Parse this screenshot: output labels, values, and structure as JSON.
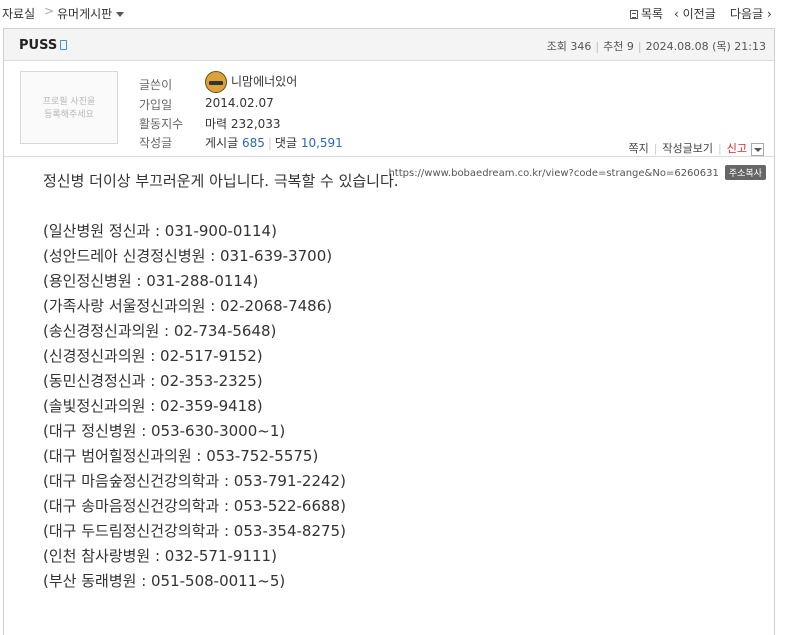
{
  "breadcrumb": {
    "section": "자료실",
    "separator": ">",
    "board": "유머게시판"
  },
  "nav": {
    "list_label": "목록",
    "prev_label": "이전글",
    "next_label": "다음글"
  },
  "post": {
    "title": "PUSS",
    "views_label": "조회",
    "views": "346",
    "recommend_label": "추천",
    "recommend": "9",
    "date": "2024.08.08 (목) 21:13"
  },
  "author": {
    "profile_placeholder": [
      "프로필 사진을",
      "등록해주세요"
    ],
    "writer_label": "글쓴이",
    "writer_name": "니맘에너있어",
    "joined_label": "가입일",
    "joined": "2014.02.07",
    "activity_label": "활동지수",
    "activity_text": "마력",
    "activity_value": "232,033",
    "posts_label": "작성글",
    "posts_text": "게시글",
    "posts_count": "685",
    "comments_text": "댓글",
    "comments_count": "10,591"
  },
  "actions": {
    "message": "쪽지",
    "view_posts": "작성글보기",
    "report": "신고"
  },
  "url": {
    "text": "https://www.bobaedream.co.kr/view?code=strange&No=6260631",
    "copy_label": "주소복사"
  },
  "body_lines": [
    "정신병 더이상 부끄러운게 아닙니다. 극복할 수 있습니다.",
    "",
    "(일산병원 정신과 : 031-900-0114)",
    "(성안드레아 신경정신병원 : 031-639-3700)",
    "(용인정신병원 : 031-288-0114)",
    "(가족사랑 서울정신과의원 : 02-2068-7486)",
    "(송신경정신과의원 : 02-734-5648)",
    "(신경정신과의원 : 02-517-9152)",
    "(동민신경정신과 : 02-353-2325)",
    "(솔빛정신과의원 : 02-359-9418)",
    "(대구 정신병원 : 053-630-3000~1)",
    "(대구 범어힐정신과의원 : 053-752-5575)",
    "(대구 마음숲정신건강의학과 : 053-791-2242)",
    "(대구 송마음정신건강의학과 : 053-522-6688)",
    "(대구 두드림정신건강의학과 : 053-354-8275)",
    "(인천 참사랑병원 : 032-571-9111)",
    "(부산 동래병원 : 051-508-0011~5)"
  ]
}
